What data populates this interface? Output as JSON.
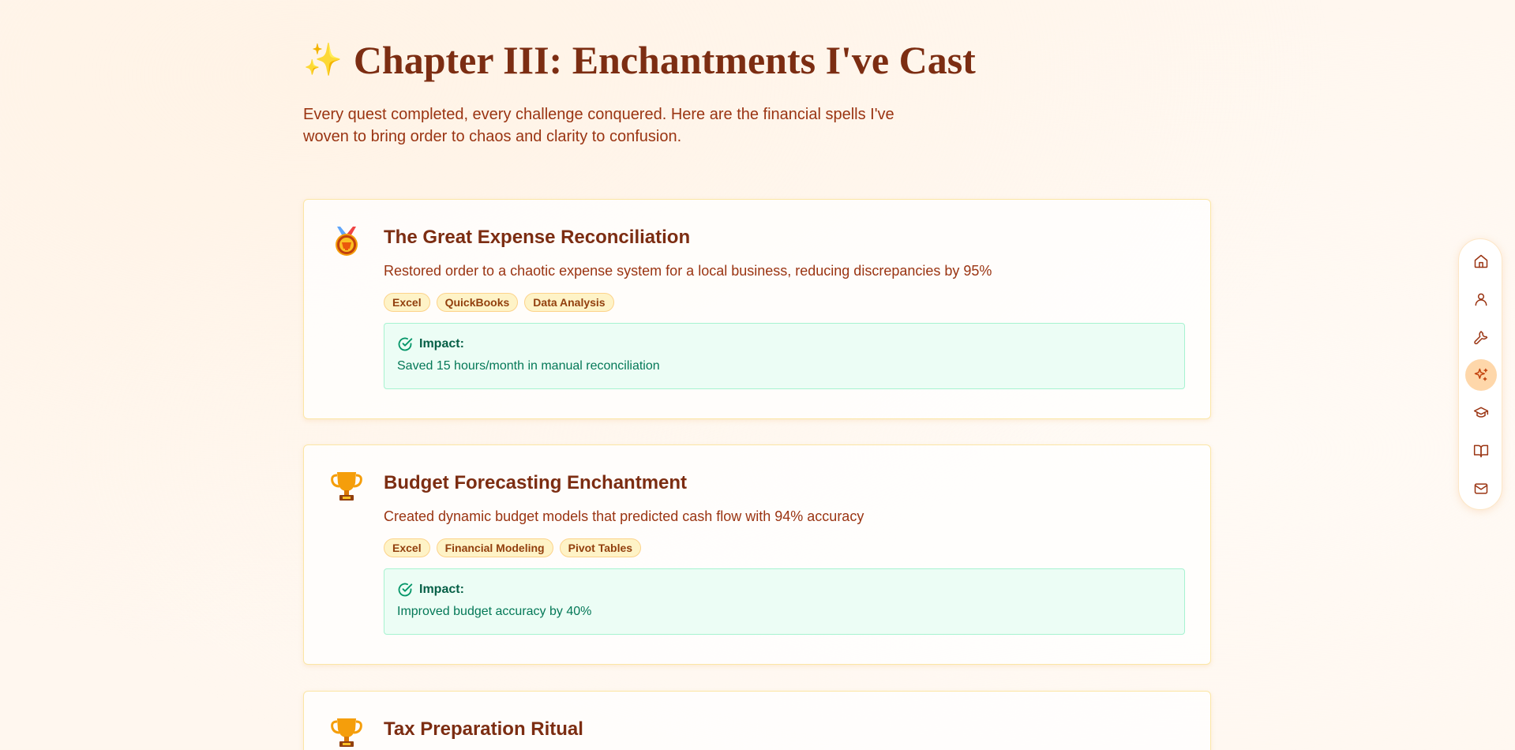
{
  "header": {
    "sparkle_icon": "✨",
    "title": "Chapter III: Enchantments I've Cast",
    "intro": "Every quest completed, every challenge conquered. Here are the financial spells I've woven to bring order to chaos and clarity to confusion."
  },
  "achievements": [
    {
      "icon": "trophy-icon",
      "title": "The Great Expense Reconciliation",
      "description": "Restored order to a chaotic expense system for a local business, reducing discrepancies by 95%",
      "tags": [
        "Excel",
        "QuickBooks",
        "Data Analysis"
      ],
      "impact_label": "Impact:",
      "impact_text": "Saved 15 hours/month in manual reconciliation"
    },
    {
      "icon": "trophy-icon",
      "title": "Budget Forecasting Enchantment",
      "description": "Created dynamic budget models that predicted cash flow with 94% accuracy",
      "tags": [
        "Excel",
        "Financial Modeling",
        "Pivot Tables"
      ],
      "impact_label": "Impact:",
      "impact_text": "Improved budget accuracy by 40%"
    },
    {
      "icon": "trophy-icon",
      "title": "Tax Preparation Ritual"
    }
  ],
  "side_nav": {
    "items": [
      "home-icon",
      "user-icon",
      "wrench-icon",
      "sparkles-icon",
      "graduation-cap-icon",
      "book-open-icon",
      "mail-icon"
    ],
    "active": "sparkles-icon"
  },
  "colors": {
    "background": "#fff7ef",
    "title": "#7c2d12",
    "tag_bg": "#fef3c7",
    "impact_bg": "#ecfdf5",
    "impact_text": "#047857",
    "nav_active": "#fed7aa"
  }
}
